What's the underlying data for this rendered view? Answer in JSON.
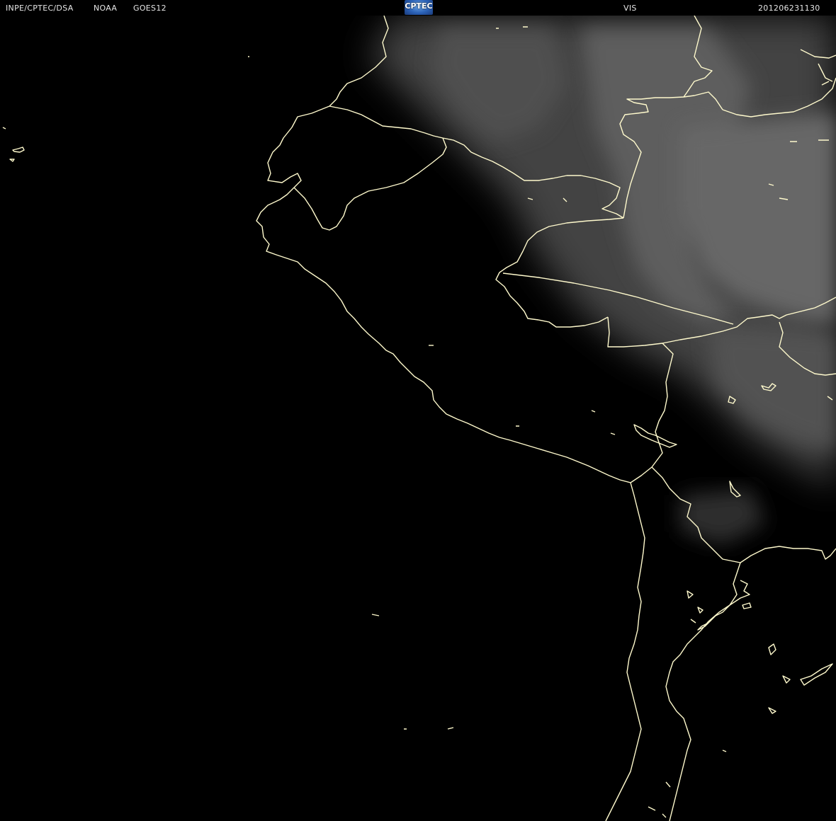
{
  "header": {
    "institution": "INPE/CPTEC/DSA",
    "agency": "NOAA",
    "satellite": "GOES12",
    "logo_text": "CPTEC",
    "channel": "VIS",
    "timestamp": "201206231130"
  },
  "colors": {
    "background": "#000000",
    "border_lines": "#fffacd",
    "cloud_tone": "#9a9a9a",
    "header_text": "#e6e6e6",
    "logo_blue": "#2b62b8"
  },
  "icons": {
    "logo": "cptec-logo"
  }
}
